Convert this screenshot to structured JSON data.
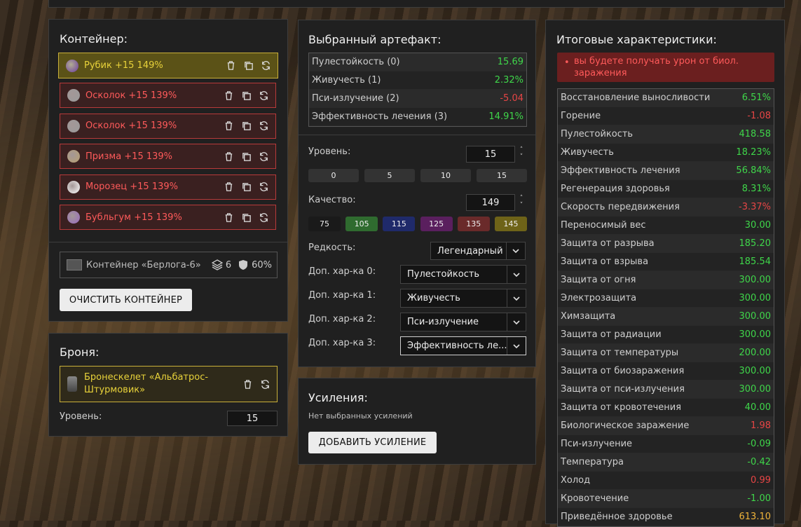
{
  "container": {
    "title": "Контейнер:",
    "items": [
      {
        "label": "Рубик +15 149%",
        "icon": "rubik-icon",
        "color": "#6a3aa0"
      },
      {
        "label": "Осколок +15 139%",
        "icon": "shard-icon",
        "color": "#9a9a9a"
      },
      {
        "label": "Осколок +15 139%",
        "icon": "shard-icon",
        "color": "#9a9a9a"
      },
      {
        "label": "Призма +15 139%",
        "icon": "prism-icon",
        "color": "#b8a070"
      },
      {
        "label": "Морозец +15 139%",
        "icon": "frost-icon",
        "color": "#ffffff"
      },
      {
        "label": "Бубльгум +15 139%",
        "icon": "bubblegum-icon",
        "color": "#9a6ac0"
      }
    ],
    "box_name": "Контейнер «Берлога-6»",
    "box_slots": "6",
    "box_protection": "60%",
    "clear_button": "ОЧИСТИТЬ КОНТЕЙНЕР"
  },
  "armor": {
    "title": "Броня:",
    "name": "Бронескелет «Альбатрос-Штурмовик»",
    "level_label": "Уровень:",
    "level_value": "15"
  },
  "artifact": {
    "title": "Выбранный артефакт:",
    "stats": [
      {
        "name": "Пулестойкость (0)",
        "value": "15.69"
      },
      {
        "name": "Живучесть (1)",
        "value": "2.32%"
      },
      {
        "name": "Пси-излучение (2)",
        "value": "-5.04"
      },
      {
        "name": "Эффективность лечения (3)",
        "value": "14.91%"
      }
    ],
    "level_label": "Уровень:",
    "level_value": "15",
    "level_presets": [
      "0",
      "5",
      "10",
      "15"
    ],
    "quality_label": "Качество:",
    "quality_value": "149",
    "quality_presets": [
      {
        "label": "75",
        "color": "#1a1a1a"
      },
      {
        "label": "105",
        "color": "#2f6b2f"
      },
      {
        "label": "115",
        "color": "#1f2a6a"
      },
      {
        "label": "125",
        "color": "#5a1f5e"
      },
      {
        "label": "135",
        "color": "#6a2a2a"
      },
      {
        "label": "145",
        "color": "#6e6318"
      }
    ],
    "rarity_label": "Редкость:",
    "rarity_value": "Легендарный",
    "extra": [
      {
        "label": "Доп. хар-ка 0:",
        "value": "Пулестойкость"
      },
      {
        "label": "Доп. хар-ка 1:",
        "value": "Живучесть"
      },
      {
        "label": "Доп. хар-ка 2:",
        "value": "Пси-излучение"
      },
      {
        "label": "Доп. хар-ка 3:",
        "value": "Эффективность ле..."
      }
    ]
  },
  "boosts": {
    "title": "Усиления:",
    "empty": "Нет выбранных усилений",
    "add_button": "ДОБАВИТЬ УСИЛЕНИЕ"
  },
  "totals": {
    "title": "Итоговые характеристики:",
    "warning": "вы будете получать урон от биол. заражения",
    "rows": [
      {
        "name": "Восстановление выносливости",
        "value": "6.51%",
        "cls": "pos"
      },
      {
        "name": "Горение",
        "value": "-1.08",
        "cls": "neg"
      },
      {
        "name": "Пулестойкость",
        "value": "418.58",
        "cls": "pos"
      },
      {
        "name": "Живучесть",
        "value": "18.23%",
        "cls": "pos"
      },
      {
        "name": "Эффективность лечения",
        "value": "56.84%",
        "cls": "pos"
      },
      {
        "name": "Регенерация здоровья",
        "value": "8.31%",
        "cls": "pos"
      },
      {
        "name": "Скорость передвижения",
        "value": "-3.37%",
        "cls": "neg"
      },
      {
        "name": "Переносимый вес",
        "value": "30.00",
        "cls": "pos"
      },
      {
        "name": "Защита от разрыва",
        "value": "185.20",
        "cls": "pos"
      },
      {
        "name": "Защита от взрыва",
        "value": "185.54",
        "cls": "pos"
      },
      {
        "name": "Защита от огня",
        "value": "300.00",
        "cls": "pos"
      },
      {
        "name": "Электрозащита",
        "value": "300.00",
        "cls": "pos"
      },
      {
        "name": "Химзащита",
        "value": "300.00",
        "cls": "pos"
      },
      {
        "name": "Защита от радиации",
        "value": "300.00",
        "cls": "pos"
      },
      {
        "name": "Защита от температуры",
        "value": "200.00",
        "cls": "pos"
      },
      {
        "name": "Защита от биозаражения",
        "value": "300.00",
        "cls": "pos"
      },
      {
        "name": "Защита от пси-излучения",
        "value": "300.00",
        "cls": "pos"
      },
      {
        "name": "Защита от кровотечения",
        "value": "40.00",
        "cls": "pos"
      },
      {
        "name": "Биологическое заражение",
        "value": "1.98",
        "cls": "neg"
      },
      {
        "name": "Пси-излучение",
        "value": "-0.09",
        "cls": "pos"
      },
      {
        "name": "Температура",
        "value": "-0.42",
        "cls": "pos"
      },
      {
        "name": "Холод",
        "value": "0.99",
        "cls": "neg"
      },
      {
        "name": "Кровотечение",
        "value": "-1.00",
        "cls": "pos"
      },
      {
        "name": "Приведённое здоровье",
        "value": "613.10",
        "cls": "gold"
      }
    ]
  }
}
